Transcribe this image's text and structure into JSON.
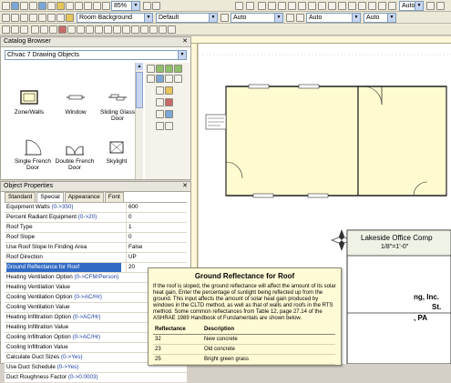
{
  "toolbar": {
    "zoom": "85%",
    "room_combo": "Room Background",
    "default_combo": "Default",
    "auto_combo_1": "Auto",
    "auto_combo_2": "Auto",
    "format_auto_1": "Auto",
    "format_auto_2": "Auto"
  },
  "catalog": {
    "title": "Catalog Browser",
    "dropdown": "Chvac 7 Drawing Objects",
    "tiles": [
      "Zone/Walls",
      "Window",
      "Sliding Glass Door",
      "Single French Door",
      "Double French Door",
      "Skylight"
    ]
  },
  "object_properties": {
    "title": "Object Properties",
    "tabs": [
      "Standard",
      "Special",
      "Appearance",
      "Font"
    ],
    "selected_tab": "Special",
    "rows": [
      {
        "key": "Equipment Watts ",
        "unit": "(0->350)",
        "value": "600"
      },
      {
        "key": "Percent Radiant Equipment ",
        "unit": "(0->20)",
        "value": "0"
      },
      {
        "key": "Roof Type",
        "unit": "",
        "value": "1"
      },
      {
        "key": "Roof Slope",
        "unit": "",
        "value": "0"
      },
      {
        "key": "Use Roof Slope In Finding Area",
        "unit": "",
        "value": "False"
      },
      {
        "key": "Roof Direction",
        "unit": "",
        "value": "UP"
      },
      {
        "key": "Ground Reflectance for Roof",
        "unit": "",
        "value": "20"
      },
      {
        "key": "Heating Ventilation Option ",
        "unit": "(0->CFM/Person)",
        "value": ""
      },
      {
        "key": "Heating Ventilation Value",
        "unit": "",
        "value": ""
      },
      {
        "key": "Cooling Ventilation Option ",
        "unit": "(0->AC/Hr)",
        "value": ""
      },
      {
        "key": "Cooling Ventilation Value",
        "unit": "",
        "value": ""
      },
      {
        "key": "Heating Infiltration Option ",
        "unit": "(0->AC/Hr)",
        "value": ""
      },
      {
        "key": "Heating Infiltration Value",
        "unit": "",
        "value": ""
      },
      {
        "key": "Cooling Infiltration Option ",
        "unit": "(0->AC/Hr)",
        "value": ""
      },
      {
        "key": "Cooling Infiltration Value",
        "unit": "",
        "value": ""
      },
      {
        "key": "Calculate Duct Sizes ",
        "unit": "(0->Yes)",
        "value": ""
      },
      {
        "key": "Use Duct Schedule ",
        "unit": "(0->Yes)",
        "value": ""
      },
      {
        "key": "Duct Roughness Factor ",
        "unit": "(0->0.0003)",
        "value": ""
      }
    ],
    "selected_row": 6
  },
  "drawing": {
    "title_block_name": "Lakeside Office Comp",
    "title_block_scale": "1/8\"=1'-0\"",
    "partial_1": "ng, Inc.",
    "partial_2": "St.",
    "partial_3": ", PA"
  },
  "popup": {
    "title": "Ground Reflectance for Roof",
    "text": "If the roof is sloped, the ground reflectance will affect the amount of its solar heat gain.  Enter the percentage of sunlight being reflected up from the ground.  This input affects the amount of solar heat gain produced by windows in the CLTD method, as well as that of walls and roofs in the RTS method.  Some common reflectances from Table 12, page 27.14 of the ASHRAE 1989 Handbook of Fundamentals are shown below.",
    "col_reflectance": "Reflectance",
    "col_description": "Description",
    "rows": [
      {
        "r": "32",
        "d": "New concrete"
      },
      {
        "r": "23",
        "d": "Old concrete"
      },
      {
        "r": "25",
        "d": "Bright green grass"
      }
    ]
  }
}
